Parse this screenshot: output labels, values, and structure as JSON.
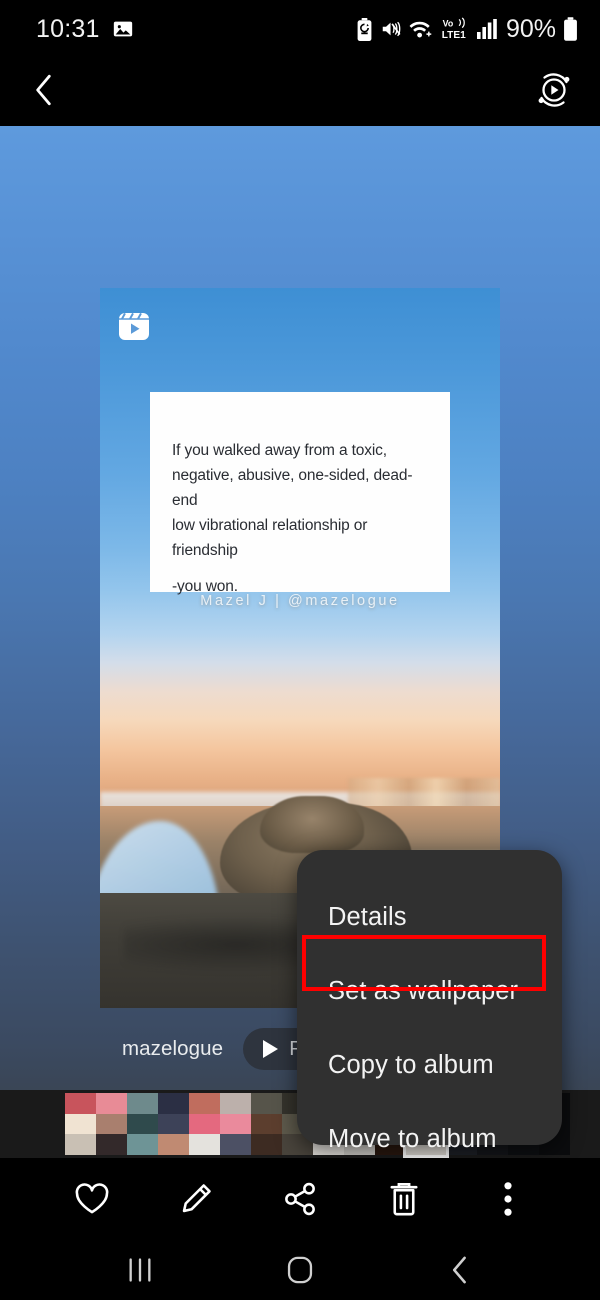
{
  "status_bar": {
    "time": "10:31",
    "battery_percent": "90%",
    "network_label": "LTE1",
    "volte_label": "Vo))",
    "icons": [
      "gallery-notification-icon",
      "battery-saver-icon",
      "mute-vibrate-icon",
      "wifi-icon",
      "volte-icon",
      "signal-bars-icon",
      "battery-icon"
    ]
  },
  "app_bar": {
    "back_label": "‹",
    "motion_photo_icon": "motion-photo-icon"
  },
  "photo": {
    "badge_icon": "reels-video-badge-icon",
    "quote": {
      "line1": "If you walked away from a toxic,",
      "line2": "negative, abusive, one-sided, dead-end",
      "line3": "low vibrational relationship or friendship",
      "line4": "-you won."
    },
    "attribution": "Mazel J | @mazelogue"
  },
  "info_bar": {
    "source_name": "mazelogue",
    "play_label": "Play",
    "play_icon": "play-triangle-icon"
  },
  "context_menu": {
    "items": [
      {
        "label": "Details",
        "highlighted": false
      },
      {
        "label": "Set as wallpaper",
        "highlighted": true
      },
      {
        "label": "Copy to album",
        "highlighted": false
      },
      {
        "label": "Move to album",
        "highlighted": false
      }
    ],
    "highlight_color": "#fe0000"
  },
  "toolbar": {
    "items": [
      {
        "name": "favorite",
        "icon": "heart-icon"
      },
      {
        "name": "edit",
        "icon": "pencil-icon"
      },
      {
        "name": "share",
        "icon": "share-icon"
      },
      {
        "name": "delete",
        "icon": "trash-icon"
      },
      {
        "name": "more",
        "icon": "more-vertical-icon"
      }
    ]
  },
  "nav_bar": {
    "recents_icon": "recents-icon",
    "home_icon": "home-icon",
    "back_icon": "back-icon"
  },
  "filmstrip": {
    "thumbnails": [
      [
        "#c8545c",
        "#f0e3d2",
        "#c9c0b4"
      ],
      [
        "#e88b96",
        "#a97f6e",
        "#33292a"
      ],
      [
        "#6e8a8c",
        "#2f4a4c",
        "#6e9496"
      ],
      [
        "#2b2f44",
        "#3d4258",
        "#c08a72"
      ],
      [
        "#c06d5e",
        "#e4697f",
        "#e4e2dd"
      ],
      [
        "#bcb0ab",
        "#ea8a9c",
        "#4c5064"
      ],
      [
        "#56544a",
        "#5c3e2e",
        "#3d2b22"
      ],
      [
        "#35332c",
        "#5e5a4c",
        "#49443c"
      ],
      [
        "#dedbd6",
        "#e3e0da",
        "#e6e3de"
      ],
      [
        "#c05a16",
        "#c8c5bf",
        "#cfcdc8"
      ],
      [
        "#c68a5a",
        "#2e1a10",
        "#2a180f"
      ],
      [
        "#f2f0ec",
        "#e6e4e0",
        "#ddd9d3"
      ]
    ],
    "selected_index": 11
  },
  "colors": {
    "background_top": "#5e9add",
    "background_bottom": "#373e48",
    "menu_background": "#303030",
    "accent_red": "#fe0000"
  }
}
